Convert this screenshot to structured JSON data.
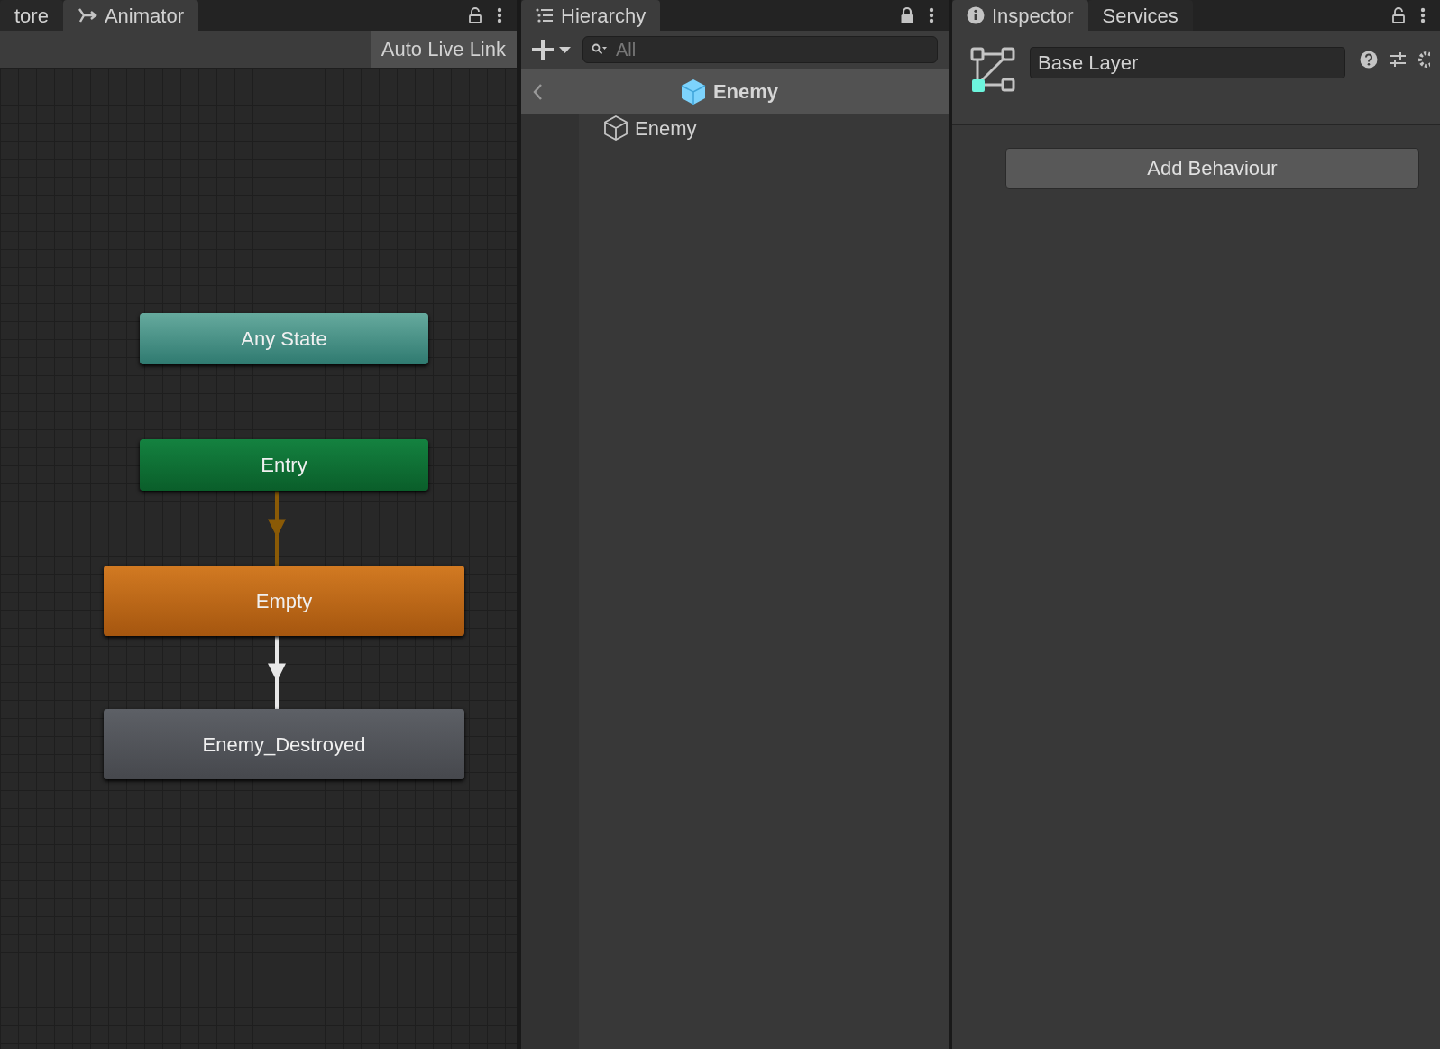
{
  "animator": {
    "tabs": [
      {
        "label": "tore",
        "selected": false
      },
      {
        "label": "Animator",
        "selected": true
      }
    ],
    "locked": false,
    "toolbar": {
      "auto_live_link": "Auto Live Link"
    },
    "nodes": [
      {
        "label": "Any State",
        "kind": "any"
      },
      {
        "label": "Entry",
        "kind": "entry"
      },
      {
        "label": "Empty",
        "kind": "default"
      },
      {
        "label": "Enemy_Destroyed",
        "kind": "normal"
      }
    ],
    "transitions": [
      {
        "color": "#8a5a06"
      },
      {
        "color": "#e8e8e8"
      }
    ]
  },
  "hierarchy": {
    "tabs": [
      {
        "label": "Hierarchy",
        "selected": true
      }
    ],
    "locked": true,
    "search": {
      "placeholder": "All"
    },
    "scene": {
      "title": "Enemy"
    },
    "items": [
      {
        "label": "Enemy"
      }
    ]
  },
  "inspector": {
    "tabs": [
      {
        "label": "Inspector",
        "selected": true
      },
      {
        "label": "Services",
        "selected": false
      }
    ],
    "locked": false,
    "name_field": "Base Layer",
    "add_button": "Add Behaviour"
  }
}
